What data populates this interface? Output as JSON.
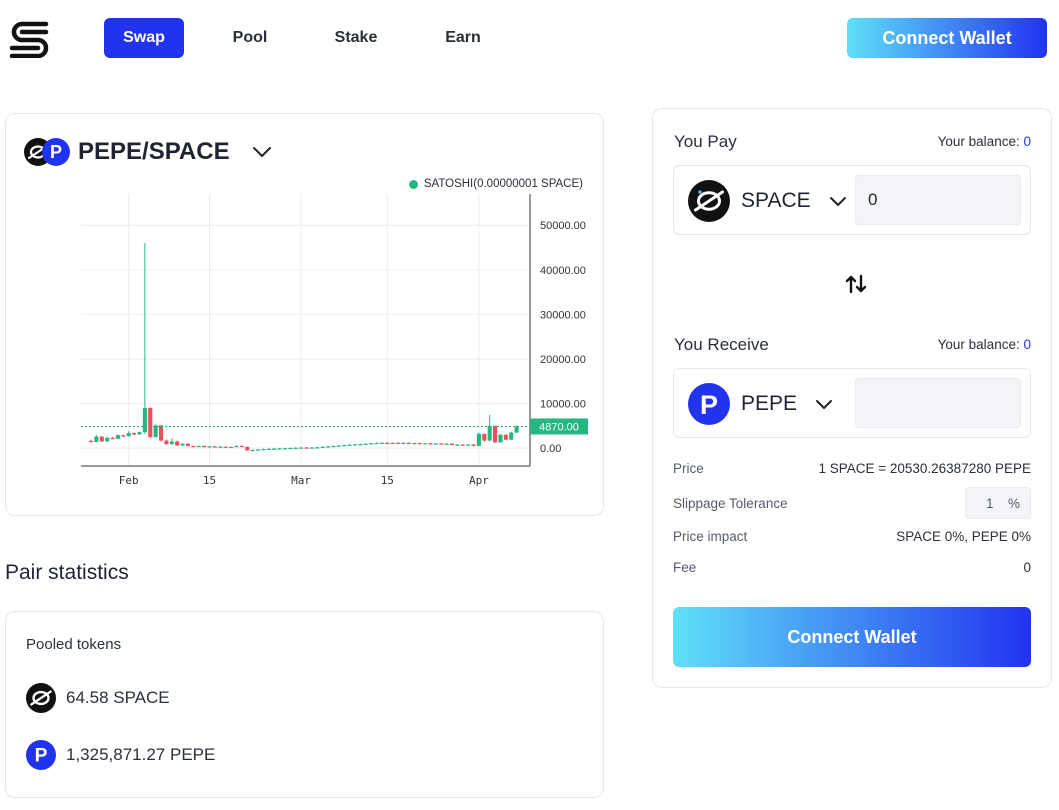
{
  "nav": {
    "tabs": [
      {
        "label": "Swap",
        "active": true
      },
      {
        "label": "Pool",
        "active": false
      },
      {
        "label": "Stake",
        "active": false
      },
      {
        "label": "Earn",
        "active": false
      }
    ],
    "connect_wallet": "Connect Wallet"
  },
  "pair": {
    "title": "PEPE/SPACE"
  },
  "chart_data": {
    "type": "candlestick",
    "legend": "SATOSHI(0.00000001 SPACE)",
    "ylim": [
      0,
      57000
    ],
    "y_ticks": [
      "50000.00",
      "40000.00",
      "30000.00",
      "20000.00",
      "10000.00",
      "0.00"
    ],
    "x_ticks": [
      "Feb",
      "15",
      "Mar",
      "15",
      "Apr"
    ],
    "last_price_label": "4870.00",
    "last_price": 4870,
    "colors": {
      "up": "#25b77f",
      "down": "#e8505b",
      "grid": "#e9ebef",
      "axis": "#333333"
    },
    "candles": [
      {
        "o": 1600,
        "c": 1500,
        "h": 1900,
        "l": 1400
      },
      {
        "o": 1400,
        "c": 2600,
        "h": 3000,
        "l": 1300
      },
      {
        "o": 2600,
        "c": 1500,
        "h": 2700,
        "l": 1400
      },
      {
        "o": 1500,
        "c": 2300,
        "h": 2600,
        "l": 1400
      },
      {
        "o": 2300,
        "c": 2100,
        "h": 2500,
        "l": 2000
      },
      {
        "o": 2100,
        "c": 2900,
        "h": 3100,
        "l": 2000
      },
      {
        "o": 2900,
        "c": 2700,
        "h": 3000,
        "l": 2500
      },
      {
        "o": 2700,
        "c": 3400,
        "h": 3800,
        "l": 2600
      },
      {
        "o": 3400,
        "c": 3100,
        "h": 3500,
        "l": 2900
      },
      {
        "o": 3100,
        "c": 3600,
        "h": 3700,
        "l": 3000
      },
      {
        "o": 3600,
        "c": 9000,
        "h": 46000,
        "l": 3200
      },
      {
        "o": 9000,
        "c": 2500,
        "h": 9200,
        "l": 2200
      },
      {
        "o": 2500,
        "c": 5100,
        "h": 5300,
        "l": 2400
      },
      {
        "o": 5100,
        "c": 1700,
        "h": 5200,
        "l": 1500
      },
      {
        "o": 1700,
        "c": 900,
        "h": 2000,
        "l": 800
      },
      {
        "o": 900,
        "c": 1500,
        "h": 2200,
        "l": 800
      },
      {
        "o": 1500,
        "c": 600,
        "h": 1700,
        "l": 500
      },
      {
        "o": 600,
        "c": 1000,
        "h": 1100,
        "l": 500
      },
      {
        "o": 1000,
        "c": 500,
        "h": 1100,
        "l": 400
      },
      {
        "o": 500,
        "c": 400,
        "h": 600,
        "l": 300
      },
      {
        "o": 400,
        "c": 500,
        "h": 600,
        "l": 300
      },
      {
        "o": 500,
        "c": 300,
        "h": 600,
        "l": 200
      },
      {
        "o": 300,
        "c": 400,
        "h": 500,
        "l": 200
      },
      {
        "o": 400,
        "c": 250,
        "h": 500,
        "l": 150
      },
      {
        "o": 250,
        "c": 350,
        "h": 450,
        "l": 150
      },
      {
        "o": 350,
        "c": 200,
        "h": 400,
        "l": 100
      },
      {
        "o": 200,
        "c": 300,
        "h": 400,
        "l": 100
      },
      {
        "o": 300,
        "c": 500,
        "h": 600,
        "l": 200
      },
      {
        "o": 500,
        "c": 300,
        "h": 600,
        "l": 200
      },
      {
        "o": 300,
        "c": -500,
        "h": 400,
        "l": -600
      },
      {
        "o": -500,
        "c": -400,
        "h": -300,
        "l": -600
      },
      {
        "o": -400,
        "c": -300,
        "h": -200,
        "l": -500
      },
      {
        "o": -300,
        "c": -200,
        "h": -100,
        "l": -400
      },
      {
        "o": -200,
        "c": -150,
        "h": -50,
        "l": -300
      },
      {
        "o": -150,
        "c": -100,
        "h": 0,
        "l": -250
      },
      {
        "o": -100,
        "c": -50,
        "h": 50,
        "l": -200
      },
      {
        "o": -50,
        "c": 0,
        "h": 100,
        "l": -150
      },
      {
        "o": 0,
        "c": 50,
        "h": 150,
        "l": -100
      },
      {
        "o": 50,
        "c": 100,
        "h": 200,
        "l": -50
      },
      {
        "o": 100,
        "c": 150,
        "h": 250,
        "l": 0
      },
      {
        "o": 150,
        "c": 100,
        "h": 250,
        "l": 0
      },
      {
        "o": 100,
        "c": 150,
        "h": 250,
        "l": 0
      },
      {
        "o": 150,
        "c": 200,
        "h": 300,
        "l": 50
      },
      {
        "o": 200,
        "c": 300,
        "h": 400,
        "l": 100
      },
      {
        "o": 300,
        "c": 400,
        "h": 500,
        "l": 200
      },
      {
        "o": 400,
        "c": 500,
        "h": 600,
        "l": 300
      },
      {
        "o": 500,
        "c": 600,
        "h": 700,
        "l": 400
      },
      {
        "o": 600,
        "c": 700,
        "h": 800,
        "l": 500
      },
      {
        "o": 700,
        "c": 800,
        "h": 900,
        "l": 600
      },
      {
        "o": 800,
        "c": 850,
        "h": 950,
        "l": 700
      },
      {
        "o": 850,
        "c": 900,
        "h": 1000,
        "l": 750
      },
      {
        "o": 900,
        "c": 1000,
        "h": 1100,
        "l": 800
      },
      {
        "o": 1000,
        "c": 1100,
        "h": 1200,
        "l": 900
      },
      {
        "o": 1100,
        "c": 1150,
        "h": 1300,
        "l": 1000
      },
      {
        "o": 1150,
        "c": 1200,
        "h": 1300,
        "l": 1050
      },
      {
        "o": 1200,
        "c": 1150,
        "h": 1300,
        "l": 1050
      },
      {
        "o": 1150,
        "c": 1200,
        "h": 1300,
        "l": 1050
      },
      {
        "o": 1200,
        "c": 1100,
        "h": 1300,
        "l": 1000
      },
      {
        "o": 1100,
        "c": 1200,
        "h": 1300,
        "l": 1000
      },
      {
        "o": 1200,
        "c": 1100,
        "h": 1300,
        "l": 1000
      },
      {
        "o": 1100,
        "c": 1150,
        "h": 1250,
        "l": 1000
      },
      {
        "o": 1150,
        "c": 1050,
        "h": 1250,
        "l": 950
      },
      {
        "o": 1050,
        "c": 1100,
        "h": 1200,
        "l": 950
      },
      {
        "o": 1100,
        "c": 1000,
        "h": 1200,
        "l": 900
      },
      {
        "o": 1000,
        "c": 1050,
        "h": 1150,
        "l": 900
      },
      {
        "o": 1050,
        "c": 950,
        "h": 1150,
        "l": 850
      },
      {
        "o": 950,
        "c": 1000,
        "h": 1100,
        "l": 850
      },
      {
        "o": 1000,
        "c": 700,
        "h": 1100,
        "l": 600
      },
      {
        "o": 700,
        "c": 800,
        "h": 900,
        "l": 600
      },
      {
        "o": 800,
        "c": 600,
        "h": 900,
        "l": 500
      },
      {
        "o": 600,
        "c": 800,
        "h": 900,
        "l": 500
      },
      {
        "o": 800,
        "c": 500,
        "h": 900,
        "l": 400
      },
      {
        "o": 500,
        "c": 3200,
        "h": 3500,
        "l": 400
      },
      {
        "o": 3200,
        "c": 1700,
        "h": 3300,
        "l": 1500
      },
      {
        "o": 1700,
        "c": 5000,
        "h": 7500,
        "l": 1600
      },
      {
        "o": 5000,
        "c": 1300,
        "h": 5100,
        "l": 1200
      },
      {
        "o": 1300,
        "c": 3000,
        "h": 3200,
        "l": 1200
      },
      {
        "o": 3000,
        "c": 1900,
        "h": 3100,
        "l": 1800
      },
      {
        "o": 1900,
        "c": 3500,
        "h": 3700,
        "l": 1800
      },
      {
        "o": 3500,
        "c": 4870,
        "h": 5100,
        "l": 3400
      }
    ]
  },
  "pair_statistics": {
    "title": "Pair statistics",
    "pooled_label": "Pooled tokens",
    "space_amount": "64.58 SPACE",
    "pepe_amount": "1,325,871.27 PEPE"
  },
  "swap": {
    "pay_label": "You Pay",
    "receive_label": "You Receive",
    "balance_label": "Your balance:",
    "pay_balance": "0",
    "receive_balance": "0",
    "pay_token": "SPACE",
    "receive_token": "PEPE",
    "pay_amount": "0",
    "receive_amount": "",
    "price_label": "Price",
    "price_value": "1 SPACE = 20530.26387280 PEPE",
    "slippage_label": "Slippage Tolerance",
    "slippage_value": "1",
    "slippage_unit": "%",
    "impact_label": "Price impact",
    "impact_value": "SPACE 0%, PEPE 0%",
    "fee_label": "Fee",
    "fee_value": "0",
    "connect_wallet": "Connect Wallet"
  },
  "icons": {
    "space_token": "space-token-icon",
    "pepe_token": "pepe-token-icon",
    "chevron": "chevron-down-icon",
    "swap_direction": "swap-arrows-icon"
  },
  "colors": {
    "accent": "#2233f0",
    "gradient_start": "#5fe0f7",
    "gradient_end": "#2233f0",
    "up": "#25b77f",
    "down": "#e8505b"
  }
}
